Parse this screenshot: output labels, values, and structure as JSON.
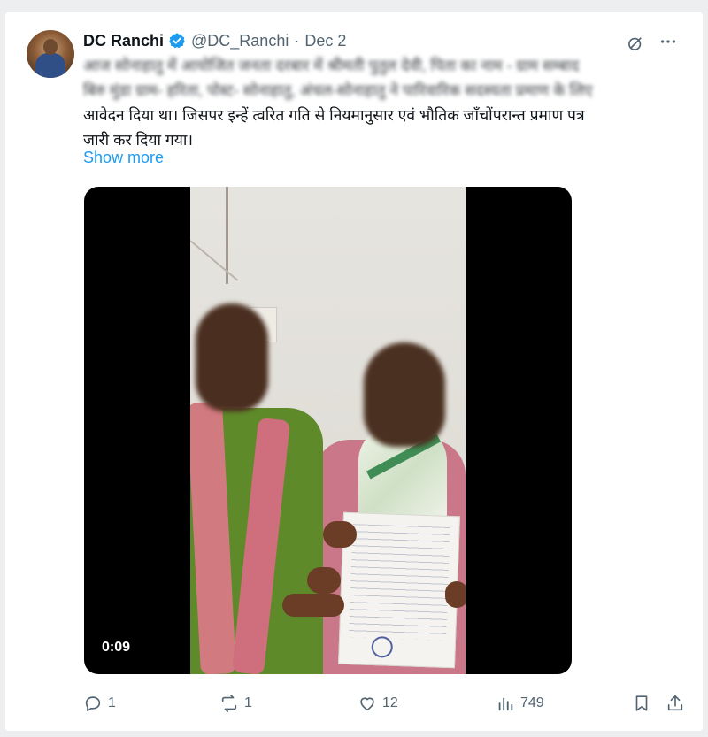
{
  "tweet": {
    "author_name": "DC Ranchi",
    "handle": "@DC_Ranchi",
    "separator": "·",
    "date": "Dec 2",
    "text_line1": "आज सोनाहातु में आयोजित जनता दरबार में श्रीमती पुतुल देवी, पिता का नाम - ग्राम सम्बाद",
    "text_line2": "बिरु मुंडा ग्राम- हरिता, पोस्ट- सोनाहातु, अंचल-सोनाहातु ने पारिवारिक सदस्यता प्रमाण के लिए",
    "text_line3": "आवेदन दिया था। जिसपर इन्हें त्वरित गति से नियमानुसार एवं भौतिक जाँचोंपरान्त प्रमाण पत्र",
    "text_line4": "जारी कर दिया गया।",
    "show_more": "Show more"
  },
  "video": {
    "duration": "0:09"
  },
  "actions": {
    "replies": "1",
    "reposts": "1",
    "likes": "12",
    "views": "749"
  },
  "colors": {
    "link": "#1d9bf0",
    "muted": "#536471",
    "verified": "#1d9bf0"
  },
  "icons": [
    "verified-badge-icon",
    "grok-icon",
    "more-icon",
    "reply-icon",
    "repost-icon",
    "like-icon",
    "views-icon",
    "bookmark-icon",
    "share-icon"
  ]
}
